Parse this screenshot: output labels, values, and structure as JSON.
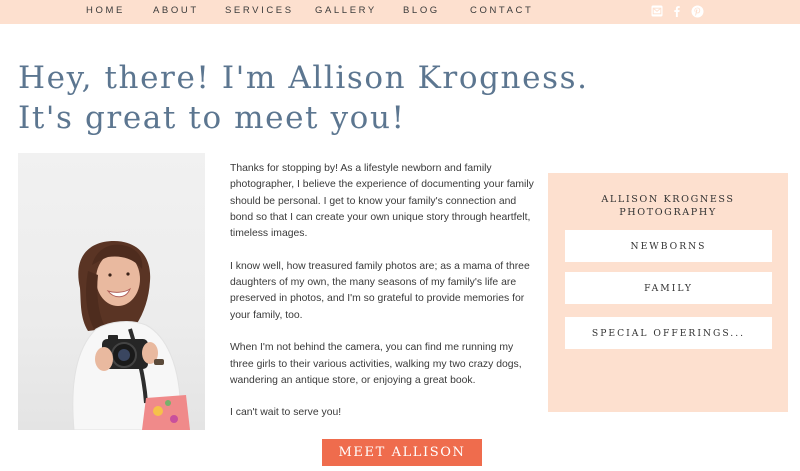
{
  "nav": {
    "items": [
      {
        "label": "HOME"
      },
      {
        "label": "ABOUT"
      },
      {
        "label": "SERVICES"
      },
      {
        "label": "GALLERY"
      },
      {
        "label": "BLOG"
      },
      {
        "label": "CONTACT"
      }
    ]
  },
  "social": [
    "email-icon",
    "facebook-icon",
    "pinterest-icon"
  ],
  "headline": {
    "line1": "Hey, there! I'm Allison Krogness.",
    "line2": "It's great to meet you!"
  },
  "bio": {
    "p1": "Thanks for stopping by! As a lifestyle newborn and family photographer, I believe the experience of documenting your family should be personal. I get to know your family's connection and bond so that I can create your own unique story through heartfelt, timeless images.",
    "p2": "I know well, how treasured family photos are; as a mama of three daughters of my own, the many seasons of my family's life are preserved in photos, and I'm so grateful to provide memories for your family, too.",
    "p3": "When I'm not behind the camera, you can find me running my three girls to their various activities, walking my two crazy dogs, wandering an antique store, or enjoying a great book.",
    "p4": "I can't wait to serve you!"
  },
  "panel": {
    "title_line1": "ALLISON KROGNESS",
    "title_line2": "PHOTOGRAPHY",
    "buttons": [
      {
        "label": "NEWBORNS"
      },
      {
        "label": "FAMILY"
      },
      {
        "label": "SPECIAL OFFERINGS..."
      }
    ]
  },
  "cta": {
    "label": "MEET ALLISON"
  },
  "colors": {
    "peach": "#fde0cf",
    "headline_blue": "#5c7690",
    "cta_orange": "#ef6c4d"
  }
}
